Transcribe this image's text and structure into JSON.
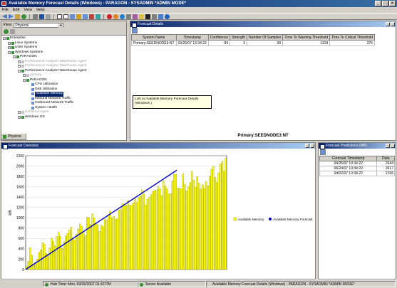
{
  "window": {
    "title": "Available Memory Forecast Details (Windows) - PARAGON - SYSADMIN *ADMIN MODE*"
  },
  "menu": [
    "File",
    "Edit",
    "View",
    "Help"
  ],
  "navigator": {
    "view_label": "View:",
    "view_value": "Physical",
    "tab_label": "Physical",
    "tree": [
      {
        "label": "Enterprise",
        "level": 0,
        "exp": "-",
        "state": "normal"
      },
      {
        "label": "Linux Systems",
        "level": 1,
        "exp": "+",
        "state": "normal"
      },
      {
        "label": "UNIX Systems",
        "level": 1,
        "exp": "+",
        "state": "normal"
      },
      {
        "label": "Windows Systems",
        "level": 1,
        "exp": "-",
        "state": "normal"
      },
      {
        "label": "PARAGON",
        "level": 2,
        "exp": "-",
        "state": "normal"
      },
      {
        "label": "Performance Analyzer Warehouse Agent",
        "level": 3,
        "exp": "+",
        "state": "dis"
      },
      {
        "label": "Performance Analyzer Warehouse Agent",
        "level": 3,
        "exp": "+",
        "state": "dis"
      },
      {
        "label": "Performance Analyzer Warehouse Agent",
        "level": 3,
        "exp": "-",
        "state": "normal"
      },
      {
        "label": "primary",
        "level": 4,
        "exp": "+",
        "state": "dis"
      },
      {
        "label": "PARAGON",
        "level": 4,
        "exp": "-",
        "state": "normal"
      },
      {
        "label": "CPU Utilization",
        "level": 5,
        "exp": "",
        "state": "normal"
      },
      {
        "label": "Disk Utilization",
        "level": 5,
        "exp": "",
        "state": "normal"
      },
      {
        "label": "Available Memory",
        "level": 5,
        "exp": "",
        "state": "sel"
      },
      {
        "label": "Inbound Network Traffic",
        "level": 5,
        "exp": "",
        "state": "normal"
      },
      {
        "label": "Outbound Network Traffic",
        "level": 5,
        "exp": "",
        "state": "normal"
      },
      {
        "label": "System Health",
        "level": 5,
        "exp": "",
        "state": "normal"
      },
      {
        "label": "Universal Agent",
        "level": 3,
        "exp": "+",
        "state": "dis"
      },
      {
        "label": "Windows OS",
        "level": 3,
        "exp": "+",
        "state": "normal"
      }
    ]
  },
  "forecast_details": {
    "title": "Forecast Details",
    "columns": [
      "System Name",
      "Timestamp",
      "Confidence",
      "Strength",
      "Number Of Samples",
      "Time To Warning Threshold",
      "Time To Critical Threshold"
    ],
    "rows": [
      [
        "Primary:SEEDNODE3:NT",
        "03/26/07 13:34:22",
        "84",
        "3",
        "90",
        "1319",
        "376"
      ]
    ],
    "tooltip": "Link to Available Memory Forecast Details (Windows )",
    "footer": "Primary:SEEDNODE3:NT"
  },
  "forecast_overview": {
    "title": "Forecast Overview"
  },
  "forecast_predictions": {
    "title": "Forecast Predictions (MB)",
    "columns": [
      "Forecast Timestamp",
      "Data"
    ],
    "rows": [
      [
        "04/25/07 13:34:22",
        "2644"
      ],
      [
        "06/24/07 13:34:22",
        "3917"
      ],
      [
        "04/02/07 13:34:22",
        "2156"
      ]
    ]
  },
  "status": {
    "hub_time": "Hub Time: Mon, 03/26/2007 01:42 PM",
    "server": "Server Available",
    "window": "Available Memory Forecast Details (Windows) - PARAGON - SYSADMIN *ADMIN MODE*"
  },
  "colors": {
    "bar": "#ffff00",
    "bar_edge": "#808000",
    "forecast": "#0000cc",
    "title_dark": "#0a246a"
  },
  "chart_data": {
    "type": "bar",
    "ylabel": "MB",
    "ylim": [
      0,
      2200
    ],
    "yticks": [
      0,
      200,
      400,
      600,
      800,
      1000,
      1200,
      1400,
      1600,
      1800,
      2000,
      2200
    ],
    "legend": [
      "Available Memory",
      "Available Memory Forecast"
    ],
    "series": [
      {
        "name": "Available Memory",
        "values": [
          60,
          160,
          420,
          280,
          100,
          140,
          200,
          330,
          380,
          520,
          490,
          310,
          300,
          420,
          610,
          550,
          460,
          640,
          720,
          640,
          410,
          540,
          650,
          700,
          770,
          820,
          610,
          570,
          680,
          780,
          880,
          840,
          740,
          660,
          1010,
          1000,
          870,
          1080,
          1000,
          900,
          870,
          740,
          860,
          830,
          980,
          960,
          1060,
          1130,
          1000,
          1030,
          970,
          980,
          1150,
          1170,
          1280,
          1240,
          1240,
          1330,
          1250,
          1240,
          1290,
          1370,
          1300,
          1390,
          1410,
          1540,
          1460,
          1250,
          1360,
          1400,
          1450,
          1510,
          1530,
          1540,
          1600,
          1560,
          1430,
          1720,
          1620,
          1560,
          1460,
          1470,
          1720,
          1840,
          1840,
          1580,
          1570,
          1560,
          1850,
          1650,
          1520,
          1600,
          1680,
          1900,
          1730,
          1590,
          1800,
          1670,
          1560,
          1640,
          1570,
          1700,
          1620,
          1800,
          1940,
          2000,
          1780,
          1680,
          1870,
          2040,
          2090,
          1900,
          2150
        ]
      },
      {
        "name": "Available Memory Forecast",
        "start": {
          "index": 0,
          "value": 0
        },
        "end": {
          "index": 85,
          "value": 1920
        }
      }
    ]
  }
}
